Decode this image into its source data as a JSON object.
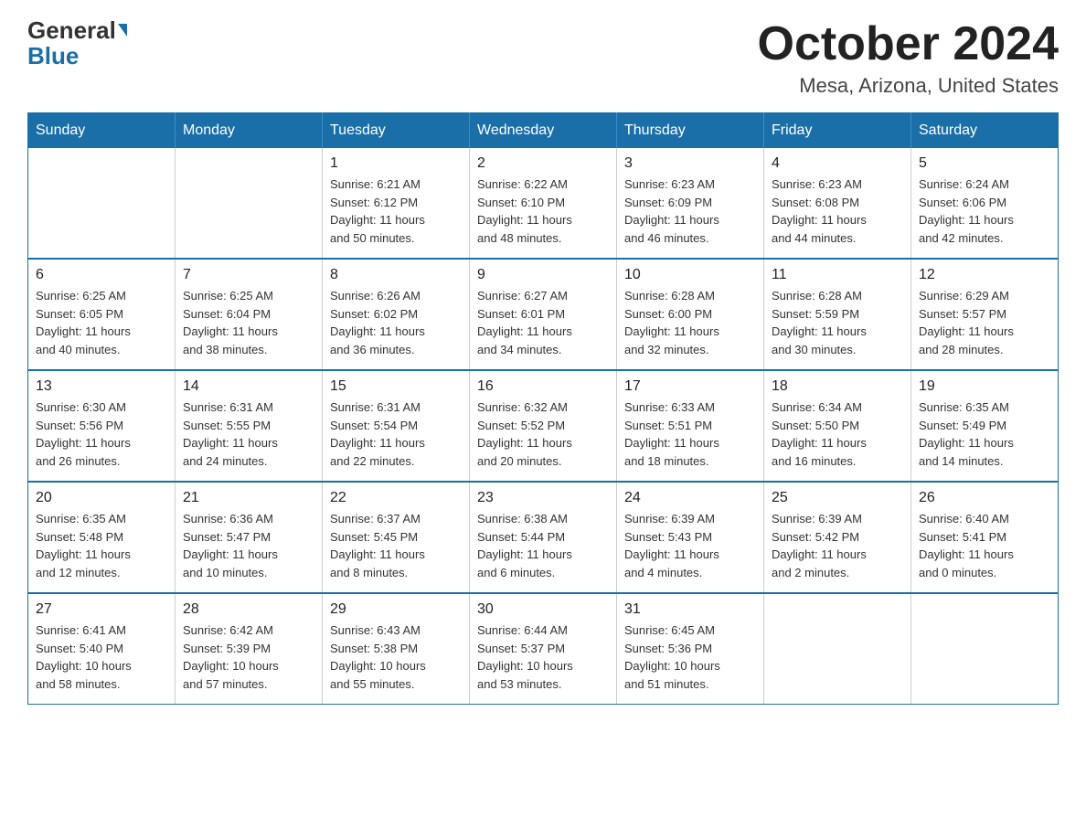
{
  "logo": {
    "general": "General",
    "blue": "Blue",
    "triangle_color": "#1a6fa8"
  },
  "header": {
    "month": "October 2024",
    "location": "Mesa, Arizona, United States"
  },
  "days_of_week": [
    "Sunday",
    "Monday",
    "Tuesday",
    "Wednesday",
    "Thursday",
    "Friday",
    "Saturday"
  ],
  "weeks": [
    [
      {
        "day": "",
        "info": ""
      },
      {
        "day": "",
        "info": ""
      },
      {
        "day": "1",
        "info": "Sunrise: 6:21 AM\nSunset: 6:12 PM\nDaylight: 11 hours\nand 50 minutes."
      },
      {
        "day": "2",
        "info": "Sunrise: 6:22 AM\nSunset: 6:10 PM\nDaylight: 11 hours\nand 48 minutes."
      },
      {
        "day": "3",
        "info": "Sunrise: 6:23 AM\nSunset: 6:09 PM\nDaylight: 11 hours\nand 46 minutes."
      },
      {
        "day": "4",
        "info": "Sunrise: 6:23 AM\nSunset: 6:08 PM\nDaylight: 11 hours\nand 44 minutes."
      },
      {
        "day": "5",
        "info": "Sunrise: 6:24 AM\nSunset: 6:06 PM\nDaylight: 11 hours\nand 42 minutes."
      }
    ],
    [
      {
        "day": "6",
        "info": "Sunrise: 6:25 AM\nSunset: 6:05 PM\nDaylight: 11 hours\nand 40 minutes."
      },
      {
        "day": "7",
        "info": "Sunrise: 6:25 AM\nSunset: 6:04 PM\nDaylight: 11 hours\nand 38 minutes."
      },
      {
        "day": "8",
        "info": "Sunrise: 6:26 AM\nSunset: 6:02 PM\nDaylight: 11 hours\nand 36 minutes."
      },
      {
        "day": "9",
        "info": "Sunrise: 6:27 AM\nSunset: 6:01 PM\nDaylight: 11 hours\nand 34 minutes."
      },
      {
        "day": "10",
        "info": "Sunrise: 6:28 AM\nSunset: 6:00 PM\nDaylight: 11 hours\nand 32 minutes."
      },
      {
        "day": "11",
        "info": "Sunrise: 6:28 AM\nSunset: 5:59 PM\nDaylight: 11 hours\nand 30 minutes."
      },
      {
        "day": "12",
        "info": "Sunrise: 6:29 AM\nSunset: 5:57 PM\nDaylight: 11 hours\nand 28 minutes."
      }
    ],
    [
      {
        "day": "13",
        "info": "Sunrise: 6:30 AM\nSunset: 5:56 PM\nDaylight: 11 hours\nand 26 minutes."
      },
      {
        "day": "14",
        "info": "Sunrise: 6:31 AM\nSunset: 5:55 PM\nDaylight: 11 hours\nand 24 minutes."
      },
      {
        "day": "15",
        "info": "Sunrise: 6:31 AM\nSunset: 5:54 PM\nDaylight: 11 hours\nand 22 minutes."
      },
      {
        "day": "16",
        "info": "Sunrise: 6:32 AM\nSunset: 5:52 PM\nDaylight: 11 hours\nand 20 minutes."
      },
      {
        "day": "17",
        "info": "Sunrise: 6:33 AM\nSunset: 5:51 PM\nDaylight: 11 hours\nand 18 minutes."
      },
      {
        "day": "18",
        "info": "Sunrise: 6:34 AM\nSunset: 5:50 PM\nDaylight: 11 hours\nand 16 minutes."
      },
      {
        "day": "19",
        "info": "Sunrise: 6:35 AM\nSunset: 5:49 PM\nDaylight: 11 hours\nand 14 minutes."
      }
    ],
    [
      {
        "day": "20",
        "info": "Sunrise: 6:35 AM\nSunset: 5:48 PM\nDaylight: 11 hours\nand 12 minutes."
      },
      {
        "day": "21",
        "info": "Sunrise: 6:36 AM\nSunset: 5:47 PM\nDaylight: 11 hours\nand 10 minutes."
      },
      {
        "day": "22",
        "info": "Sunrise: 6:37 AM\nSunset: 5:45 PM\nDaylight: 11 hours\nand 8 minutes."
      },
      {
        "day": "23",
        "info": "Sunrise: 6:38 AM\nSunset: 5:44 PM\nDaylight: 11 hours\nand 6 minutes."
      },
      {
        "day": "24",
        "info": "Sunrise: 6:39 AM\nSunset: 5:43 PM\nDaylight: 11 hours\nand 4 minutes."
      },
      {
        "day": "25",
        "info": "Sunrise: 6:39 AM\nSunset: 5:42 PM\nDaylight: 11 hours\nand 2 minutes."
      },
      {
        "day": "26",
        "info": "Sunrise: 6:40 AM\nSunset: 5:41 PM\nDaylight: 11 hours\nand 0 minutes."
      }
    ],
    [
      {
        "day": "27",
        "info": "Sunrise: 6:41 AM\nSunset: 5:40 PM\nDaylight: 10 hours\nand 58 minutes."
      },
      {
        "day": "28",
        "info": "Sunrise: 6:42 AM\nSunset: 5:39 PM\nDaylight: 10 hours\nand 57 minutes."
      },
      {
        "day": "29",
        "info": "Sunrise: 6:43 AM\nSunset: 5:38 PM\nDaylight: 10 hours\nand 55 minutes."
      },
      {
        "day": "30",
        "info": "Sunrise: 6:44 AM\nSunset: 5:37 PM\nDaylight: 10 hours\nand 53 minutes."
      },
      {
        "day": "31",
        "info": "Sunrise: 6:45 AM\nSunset: 5:36 PM\nDaylight: 10 hours\nand 51 minutes."
      },
      {
        "day": "",
        "info": ""
      },
      {
        "day": "",
        "info": ""
      }
    ]
  ]
}
